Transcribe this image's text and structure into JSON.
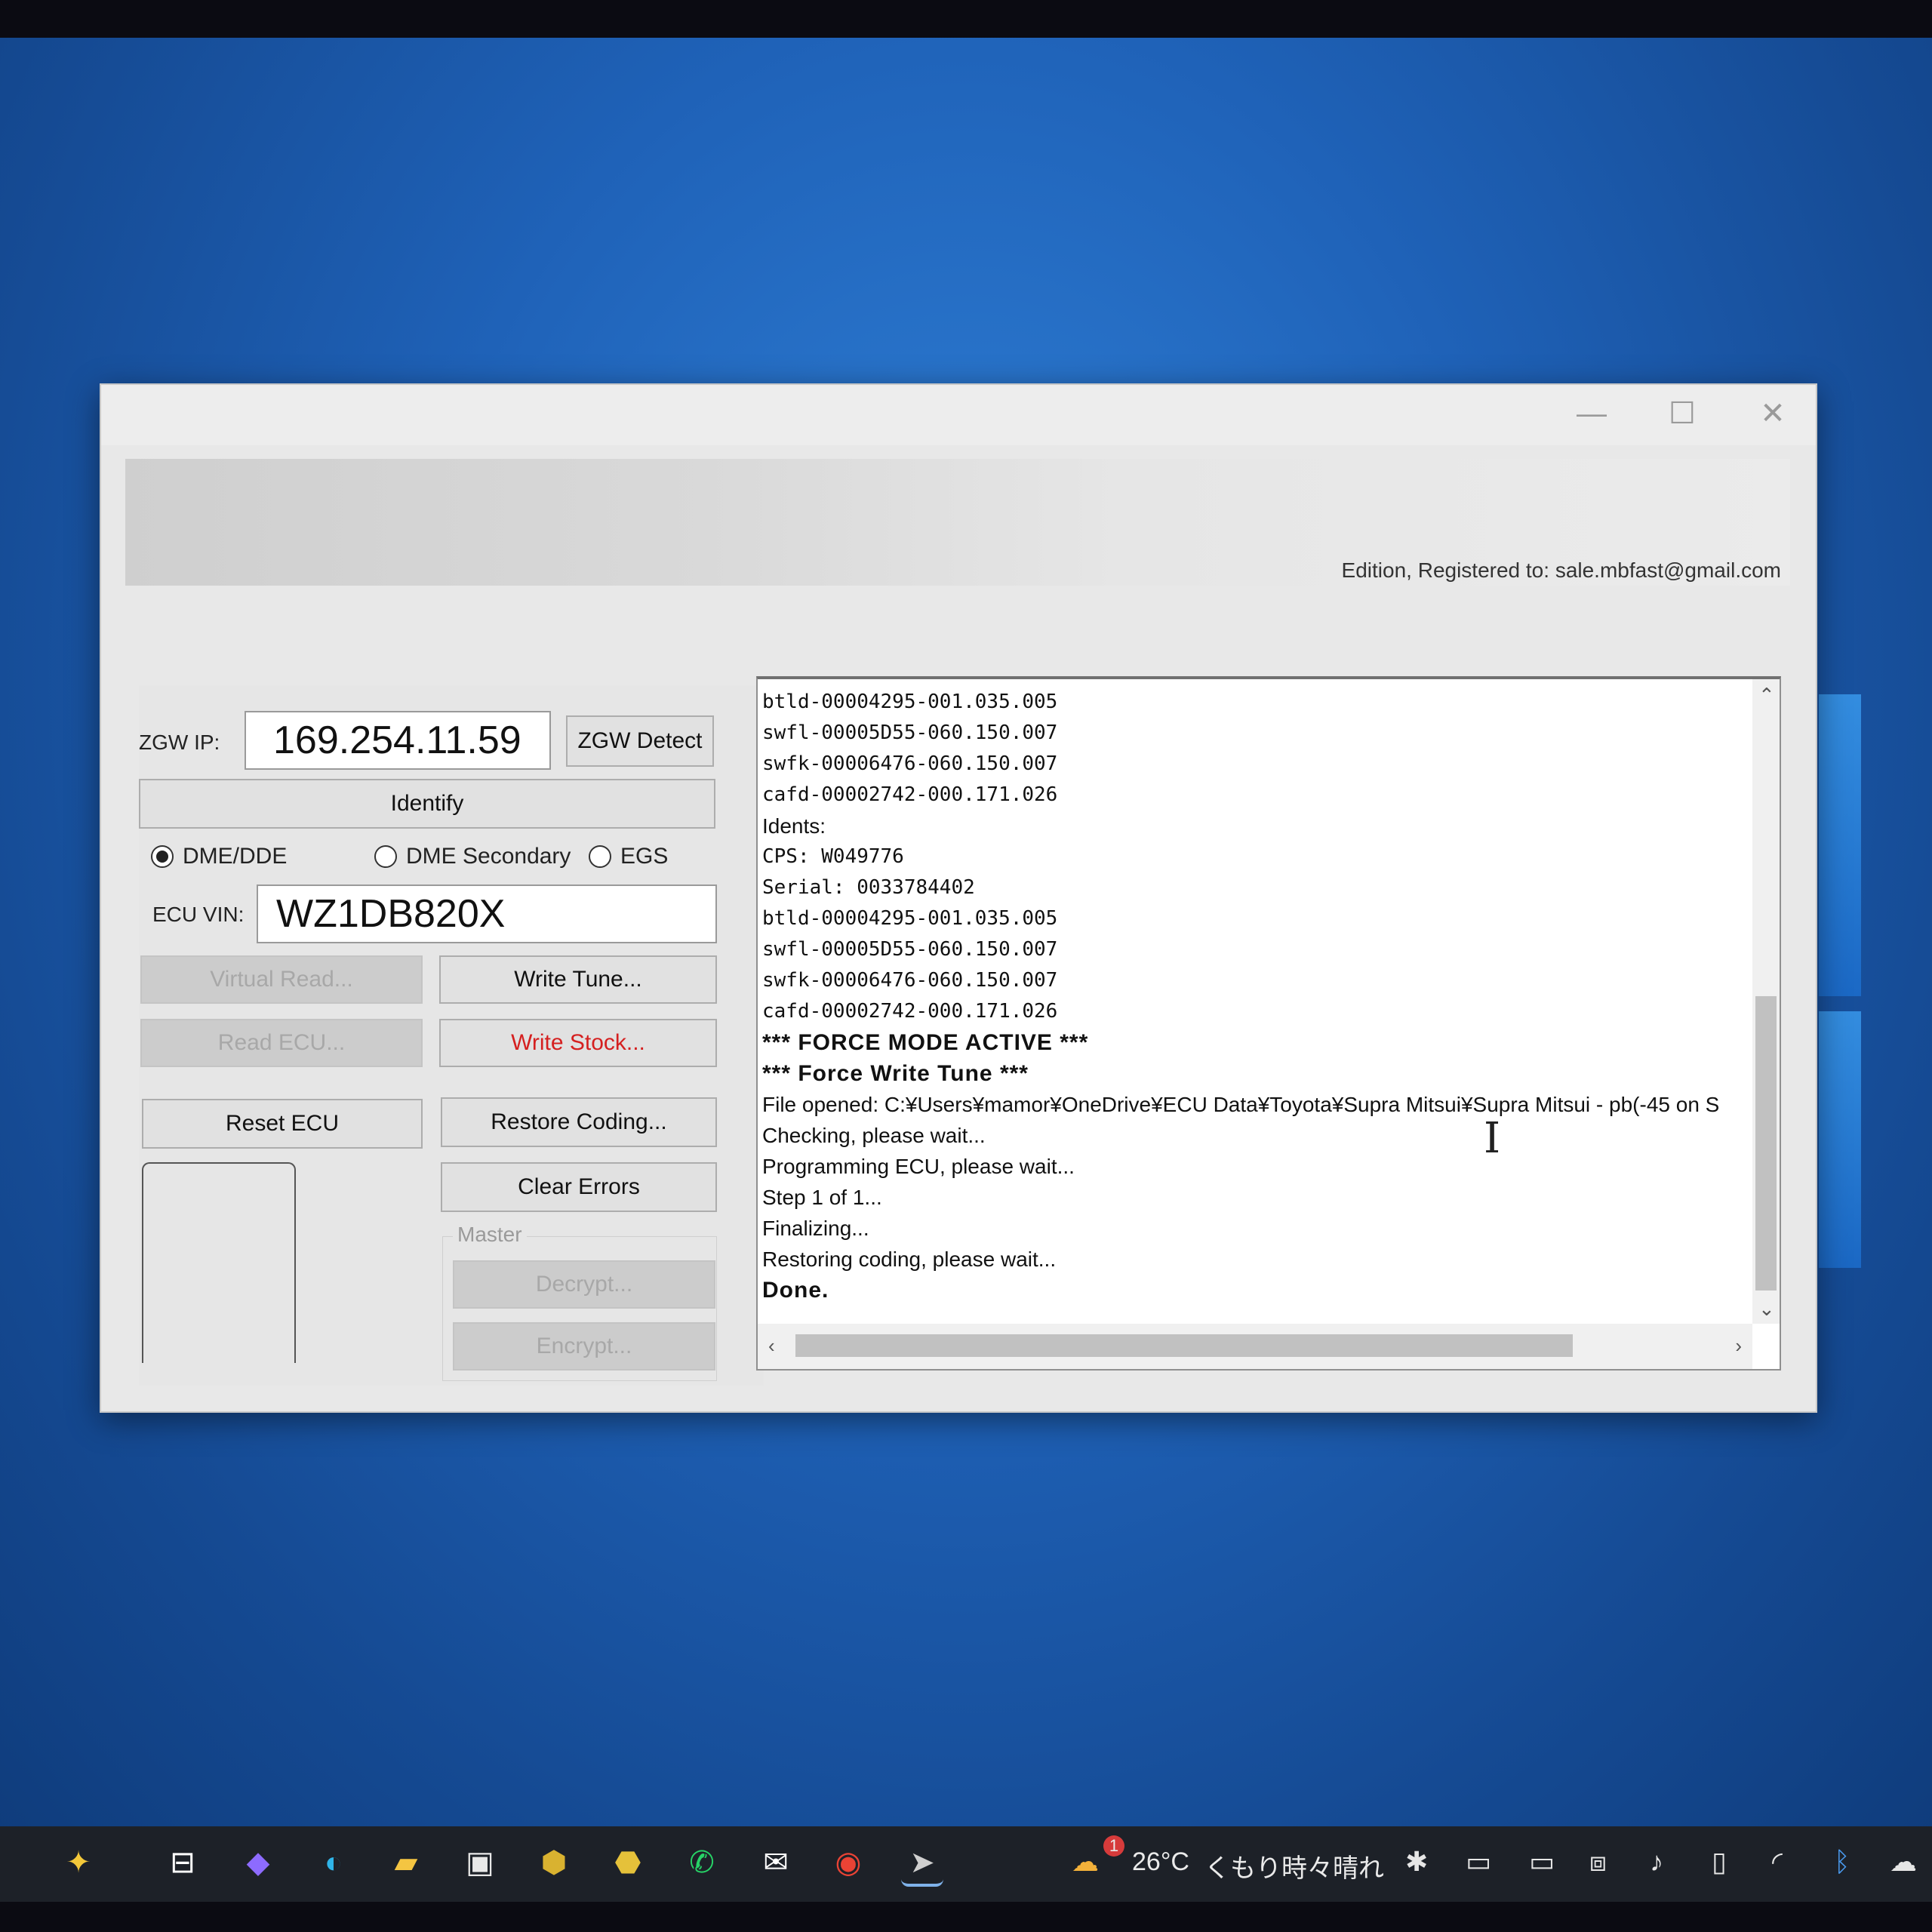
{
  "window": {
    "registered_text": "Edition, Registered to: sale.mbfast@gmail.com",
    "minimize": "—",
    "maximize": "☐",
    "close": "✕"
  },
  "controls": {
    "zgw_ip_label": "ZGW IP:",
    "zgw_ip_value": "169.254.11.59",
    "zgw_detect": "ZGW Detect",
    "identify": "Identify",
    "radio_dme": "DME/DDE",
    "radio_dme_secondary": "DME Secondary",
    "radio_egs": "EGS",
    "selected_radio": "DME/DDE",
    "ecu_vin_label": "ECU VIN:",
    "ecu_vin_value": "WZ1DB820X",
    "virtual_read": "Virtual Read...",
    "write_tune": "Write Tune...",
    "read_ecu": "Read ECU...",
    "write_stock": "Write Stock...",
    "reset_ecu": "Reset ECU",
    "restore_coding": "Restore Coding...",
    "clear_errors": "Clear Errors",
    "master_label": "Master",
    "decrypt": "Decrypt...",
    "encrypt": "Encrypt..."
  },
  "log": {
    "lines": [
      {
        "text": "btld-00004295-001.035.005",
        "style": "mono"
      },
      {
        "text": "swfl-00005D55-060.150.007",
        "style": "mono"
      },
      {
        "text": "swfk-00006476-060.150.007",
        "style": "mono"
      },
      {
        "text": "cafd-00002742-000.171.026",
        "style": "mono"
      },
      {
        "text": "Idents:",
        "style": "normal"
      },
      {
        "text": "CPS: W049776",
        "style": "mono"
      },
      {
        "text": "Serial: 0033784402",
        "style": "mono"
      },
      {
        "text": "btld-00004295-001.035.005",
        "style": "mono"
      },
      {
        "text": "swfl-00005D55-060.150.007",
        "style": "mono"
      },
      {
        "text": "swfk-00006476-060.150.007",
        "style": "mono"
      },
      {
        "text": "cafd-00002742-000.171.026",
        "style": "mono"
      },
      {
        "text": "*** FORCE MODE ACTIVE ***",
        "style": "bold"
      },
      {
        "text": "*** Force Write Tune ***",
        "style": "bold"
      },
      {
        "text": "File opened: C:¥Users¥mamor¥OneDrive¥ECU Data¥Toyota¥Supra Mitsui¥Supra Mitsui - pb(-45 on S",
        "style": "normal"
      },
      {
        "text": "Checking, please wait...",
        "style": "normal"
      },
      {
        "text": "Programming ECU, please wait...",
        "style": "normal"
      },
      {
        "text": "Step 1 of 1...",
        "style": "normal"
      },
      {
        "text": "Finalizing...",
        "style": "normal"
      },
      {
        "text": "Restoring coding, please wait...",
        "style": "normal"
      },
      {
        "text": "Done.",
        "style": "bold"
      }
    ]
  },
  "taskbar": {
    "weather_temp": "26°C",
    "weather_text": "くもり時々晴れ",
    "weather_badge": "1"
  }
}
